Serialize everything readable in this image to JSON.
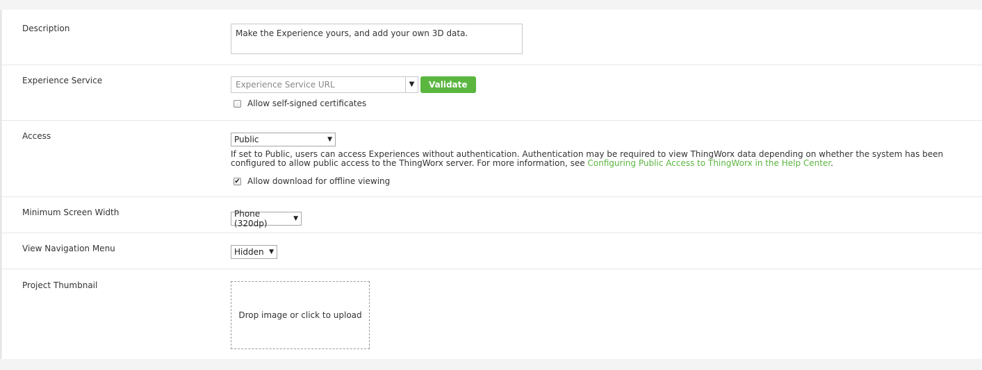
{
  "description": {
    "label": "Description",
    "value": "Make the Experience yours, and add your own 3D data."
  },
  "experience_service": {
    "label": "Experience Service",
    "placeholder": "Experience Service URL",
    "dropdown_icon": "caret-down-icon",
    "validate_label": "Validate",
    "self_signed_label": "Allow self-signed certificates",
    "self_signed_checked": false
  },
  "access": {
    "label": "Access",
    "selected": "Public",
    "help_text": "If set to Public, users can access Experiences without authentication. Authentication may be required to view ThingWorx data depending on whether the system has been configured to allow public access to the ThingWorx server. For more information, see ",
    "help_link": "Configuring Public Access to ThingWorx in the Help Center",
    "help_suffix": ".",
    "offline_label": "Allow download for offline viewing",
    "offline_checked": true
  },
  "min_screen_width": {
    "label": "Minimum Screen Width",
    "selected": "Phone (320dp)"
  },
  "view_navigation_menu": {
    "label": "View Navigation Menu",
    "selected": "Hidden"
  },
  "project_thumbnail": {
    "label": "Project Thumbnail",
    "dropzone_text": "Drop image or click to upload"
  },
  "colors": {
    "accent": "#5bb640",
    "page_bg": "#f4f4f4",
    "panel_bg": "#ffffff"
  }
}
